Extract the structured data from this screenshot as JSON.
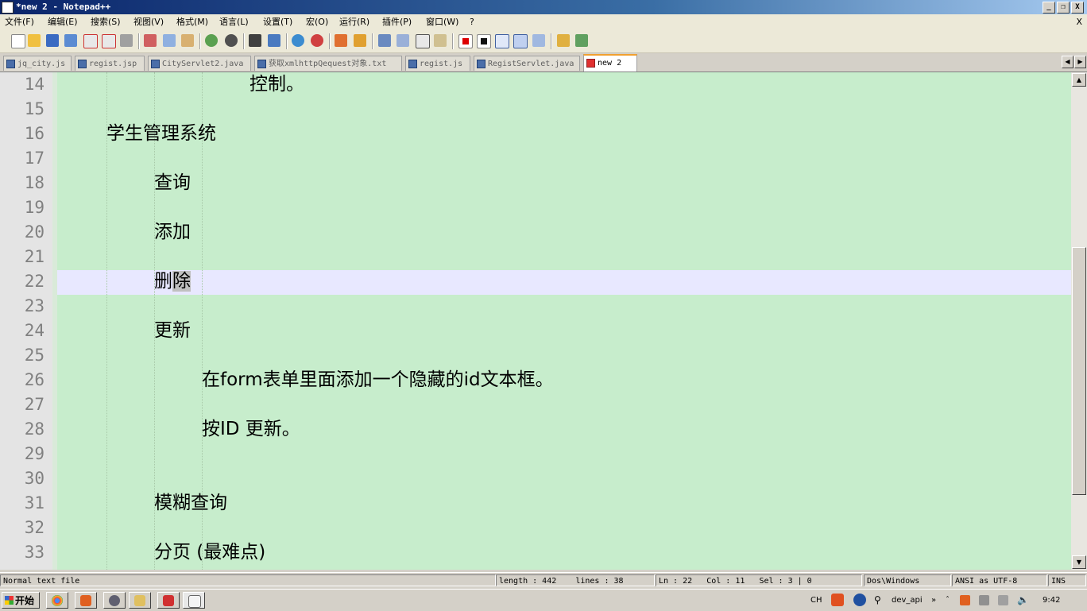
{
  "window": {
    "title": "*new  2 - Notepad++",
    "buttons": [
      "_",
      "❐",
      "X"
    ]
  },
  "menu": {
    "items": [
      "文件(F)",
      "编辑(E)",
      "搜索(S)",
      "视图(V)",
      "格式(M)",
      "语言(L)",
      "设置(T)",
      "宏(O)",
      "运行(R)",
      "插件(P)",
      "窗口(W)",
      "?"
    ],
    "close": "X"
  },
  "toolbar": {
    "icons": [
      "new-file-icon",
      "open-file-icon",
      "save-icon",
      "save-all-icon",
      "close-file-icon",
      "close-all-icon",
      "print-icon",
      "cut-icon",
      "copy-icon",
      "paste-icon",
      "undo-icon",
      "redo-icon",
      "find-icon",
      "replace-icon",
      "zoom-in-icon",
      "zoom-out-icon",
      "sync-v-icon",
      "sync-h-icon",
      "wrap-icon",
      "show-all-chars-icon",
      "indent-guide-icon",
      "doc-map-icon",
      "record-macro-icon",
      "stop-macro-icon",
      "play-macro-icon",
      "run-macro-multiple-icon",
      "save-macro-icon",
      "open-folder-icon",
      "spellcheck-icon"
    ]
  },
  "tabs": [
    {
      "label": "jq_city.js",
      "active": false
    },
    {
      "label": "regist.jsp",
      "active": false
    },
    {
      "label": "CityServlet2.java",
      "active": false
    },
    {
      "label": "获取xmlhttpQequest对象.txt",
      "active": false
    },
    {
      "label": "regist.js",
      "active": false
    },
    {
      "label": "RegistServlet.java",
      "active": false
    },
    {
      "label": "new  2",
      "active": true
    }
  ],
  "editor": {
    "lines": [
      {
        "n": "14",
        "indent": 4,
        "text": "控制。"
      },
      {
        "n": "15",
        "indent": 0,
        "text": ""
      },
      {
        "n": "16",
        "indent": 1,
        "text": "学生管理系统"
      },
      {
        "n": "17",
        "indent": 0,
        "text": ""
      },
      {
        "n": "18",
        "indent": 2,
        "text": "查询"
      },
      {
        "n": "19",
        "indent": 0,
        "text": ""
      },
      {
        "n": "20",
        "indent": 2,
        "text": "添加"
      },
      {
        "n": "21",
        "indent": 0,
        "text": ""
      },
      {
        "n": "22",
        "indent": 2,
        "text": "删",
        "selected": "除"
      },
      {
        "n": "23",
        "indent": 0,
        "text": ""
      },
      {
        "n": "24",
        "indent": 2,
        "text": "更新"
      },
      {
        "n": "25",
        "indent": 0,
        "text": ""
      },
      {
        "n": "26",
        "indent": 3,
        "text": "在form表单里面添加一个隐藏的id文本框。"
      },
      {
        "n": "27",
        "indent": 0,
        "text": ""
      },
      {
        "n": "28",
        "indent": 3,
        "text": "按ID 更新。"
      },
      {
        "n": "29",
        "indent": 0,
        "text": ""
      },
      {
        "n": "30",
        "indent": 0,
        "text": ""
      },
      {
        "n": "31",
        "indent": 2,
        "text": "模糊查询"
      },
      {
        "n": "32",
        "indent": 0,
        "text": ""
      },
      {
        "n": "33",
        "indent": 2,
        "text": "分页 (最难点)"
      }
    ]
  },
  "status": {
    "filetype": "Normal text file",
    "length": "length : 442",
    "lines": "lines : 38",
    "ln": "Ln : 22",
    "col": "Col : 11",
    "sel": "Sel : 3 | 0",
    "eol": "Dos\\Windows",
    "encoding": "ANSI as UTF-8",
    "mode": "INS"
  },
  "taskbar": {
    "start": "开始",
    "lang": "CH",
    "user": "dev_api",
    "clock": "9:42"
  }
}
